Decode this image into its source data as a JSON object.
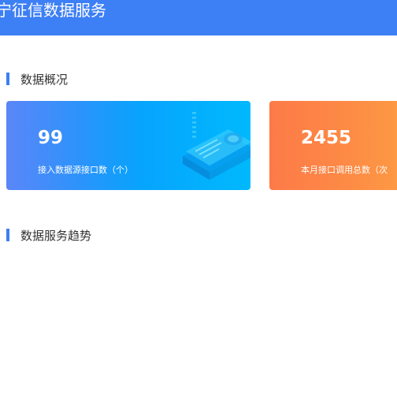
{
  "header": {
    "title": "宁征信数据服务"
  },
  "overview": {
    "section_title": "数据概况",
    "cards": [
      {
        "value": "99",
        "label": "接入数据源接口数（个）"
      },
      {
        "value": "2455",
        "label": "本月接口调用总数（次"
      }
    ]
  },
  "trend": {
    "section_title": "数据服务趋势"
  },
  "colors": {
    "header_bg": "#3d7ff5",
    "accent_bar": "#3d7ff5",
    "card_blue_start": "#5b86f8",
    "card_blue_end": "#00b9fd",
    "card_orange_start": "#fd7a48",
    "card_orange_end": "#fd9a44"
  },
  "icons": {
    "card_blue_illustration": "book-device-icon"
  }
}
